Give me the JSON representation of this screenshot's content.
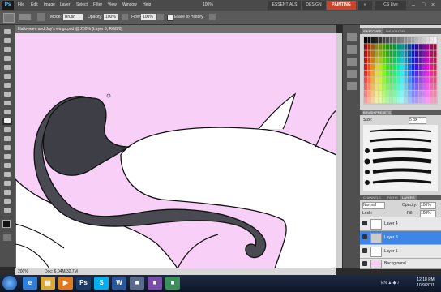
{
  "app": {
    "logo": "Ps"
  },
  "menu": [
    "File",
    "Edit",
    "Image",
    "Layer",
    "Select",
    "Filter",
    "View",
    "Window",
    "Help"
  ],
  "zoom_display": "100%",
  "workspace": {
    "essentials": "ESSENTIALS",
    "design": "DESIGN",
    "painting": "PAINTING",
    "cslive": "CS Live"
  },
  "options": {
    "mode_label": "Mode:",
    "mode_value": "Brush",
    "opacity_label": "Opacity:",
    "opacity_value": "100%",
    "flow_label": "Flow:",
    "flow_value": "100%",
    "erase_history": "Erase to History"
  },
  "document": {
    "tab_title": "Halloween and Jay's wings.psd @ 200% (Layer 3, RGB/8)"
  },
  "status": {
    "zoom": "200%",
    "doc_info": "Doc: 6.04M/32.7M"
  },
  "panels": {
    "swatches_tabs": [
      "SWATCHES",
      "NAVIGATOR"
    ],
    "brush_tabs": [
      "BRUSH PRESETS"
    ],
    "brush_size_label": "Size:",
    "brush_size_value": "5 px",
    "layer_tabs": [
      "CHANNELS",
      "PATHS",
      "LAYERS"
    ],
    "blend_mode": "Normal",
    "opacity_label": "Opacity:",
    "opacity_value": "100%",
    "lock_label": "Lock:",
    "fill_label": "Fill:",
    "fill_value": "100%",
    "layers": [
      {
        "name": "Layer 4",
        "selected": false
      },
      {
        "name": "Layer 3",
        "selected": true
      },
      {
        "name": "Layer 1",
        "selected": false
      },
      {
        "name": "Background",
        "selected": false
      }
    ]
  },
  "taskbar": {
    "apps": [
      {
        "icon": "ie-icon",
        "glyph": "e",
        "color": "#2f7fd6"
      },
      {
        "icon": "folder-icon",
        "glyph": "▤",
        "color": "#d9a73a"
      },
      {
        "icon": "media-player-icon",
        "glyph": "▶",
        "color": "#e07a1f"
      },
      {
        "icon": "photoshop-icon",
        "glyph": "Ps",
        "color": "#1b3a66"
      },
      {
        "icon": "skype-icon",
        "glyph": "S",
        "color": "#00aff0"
      },
      {
        "icon": "word-icon",
        "glyph": "W",
        "color": "#2b579a"
      },
      {
        "icon": "app-icon",
        "glyph": "■",
        "color": "#5a6b8c"
      },
      {
        "icon": "app-icon-2",
        "glyph": "■",
        "color": "#7a4ba8"
      },
      {
        "icon": "app-icon-3",
        "glyph": "■",
        "color": "#3a8f5a"
      }
    ],
    "time": "12:18 PM",
    "date": "10/9/2011"
  }
}
